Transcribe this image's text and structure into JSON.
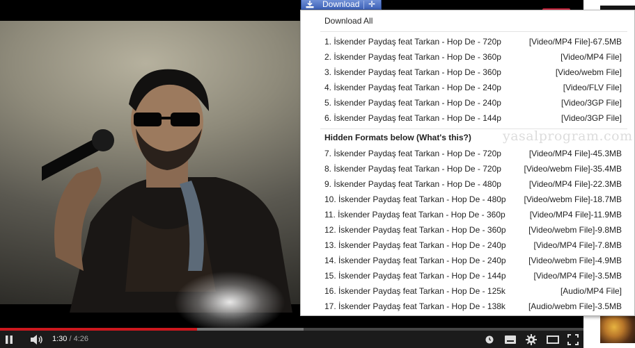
{
  "player": {
    "current_time": "1:30",
    "duration": "/ 4:26",
    "progress_fraction": 0.338,
    "loaded_fraction": 0.52
  },
  "download_button": {
    "label": "Download"
  },
  "menu": {
    "download_all": "Download All",
    "formats": [
      {
        "title": "1. İskender Paydaş feat Tarkan - Hop De - 720p",
        "format": "[Video/MP4 File]-67.5MB"
      },
      {
        "title": "2. İskender Paydaş feat Tarkan - Hop De - 360p",
        "format": "[Video/MP4 File]"
      },
      {
        "title": "3. İskender Paydaş feat Tarkan - Hop De - 360p",
        "format": "[Video/webm File]"
      },
      {
        "title": "4. İskender Paydaş feat Tarkan - Hop De - 240p",
        "format": "[Video/FLV File]"
      },
      {
        "title": "5. İskender Paydaş feat Tarkan - Hop De - 240p",
        "format": "[Video/3GP File]"
      },
      {
        "title": "6. İskender Paydaş feat Tarkan - Hop De - 144p",
        "format": "[Video/3GP File]"
      }
    ],
    "hidden_heading": "Hidden Formats below (What's this?)",
    "hidden_formats": [
      {
        "title": "7. İskender Paydaş feat Tarkan - Hop De - 720p",
        "format": "[Video/MP4 File]-45.3MB"
      },
      {
        "title": "8. İskender Paydaş feat Tarkan - Hop De - 720p",
        "format": "[Video/webm File]-35.4MB"
      },
      {
        "title": "9. İskender Paydaş feat Tarkan - Hop De - 480p",
        "format": "[Video/MP4 File]-22.3MB"
      },
      {
        "title": "10. İskender Paydaş feat Tarkan - Hop De - 480p",
        "format": "[Video/webm File]-18.7MB"
      },
      {
        "title": "11. İskender Paydaş feat Tarkan - Hop De - 360p",
        "format": "[Video/MP4 File]-11.9MB"
      },
      {
        "title": "12. İskender Paydaş feat Tarkan - Hop De - 360p",
        "format": "[Video/webm File]-9.8MB"
      },
      {
        "title": "13. İskender Paydaş feat Tarkan - Hop De - 240p",
        "format": "[Video/MP4 File]-7.8MB"
      },
      {
        "title": "14. İskender Paydaş feat Tarkan - Hop De - 240p",
        "format": "[Video/webm File]-4.9MB"
      },
      {
        "title": "15. İskender Paydaş feat Tarkan - Hop De - 144p",
        "format": "[Video/MP4 File]-3.5MB"
      },
      {
        "title": "16. İskender Paydaş feat Tarkan - Hop De - 125k",
        "format": "[Audio/MP4 File]"
      },
      {
        "title": "17. İskender Paydaş feat Tarkan - Hop De - 138k",
        "format": "[Audio/webm File]-3.5MB"
      }
    ]
  },
  "watermark": "yasalprogram.com",
  "icons": [
    "download-icon",
    "move-icon",
    "pause-icon",
    "volume-icon",
    "clock-icon",
    "subtitles-icon",
    "settings-gear-icon",
    "miniplayer-icon",
    "fullscreen-icon"
  ],
  "colors": {
    "progress_played": "#cc181e",
    "download_button": "#4a6cc0",
    "menu_background": "#ffffff"
  }
}
